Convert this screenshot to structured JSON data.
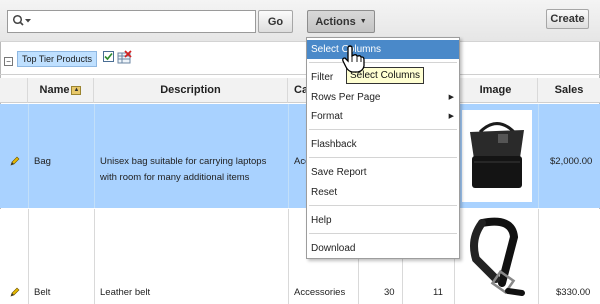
{
  "toolbar": {
    "search_value": "",
    "go_label": "Go",
    "actions_label": "Actions",
    "create_label": "Create"
  },
  "filters": {
    "chip_label": "Top Tier Products"
  },
  "table": {
    "headers": [
      "Name",
      "Description",
      "Ca",
      "Image",
      "Sales"
    ],
    "rows": [
      {
        "name": "Bag",
        "description": "Unisex bag suitable for carrying laptops with room for many additional items",
        "category": "Acc",
        "sales": "$2,000.00"
      },
      {
        "name": "Belt",
        "description": "Leather belt",
        "category": "Accessories",
        "col4": "30",
        "col5": "11",
        "sales": "$330.00"
      }
    ]
  },
  "actions_menu": {
    "items": [
      {
        "label": "Select Columns",
        "submenu": false,
        "active": true
      },
      {
        "label": "Filter",
        "submenu": false
      },
      {
        "label": "Rows Per Page",
        "submenu": true
      },
      {
        "label": "Format",
        "submenu": true
      },
      {
        "label": "Flashback",
        "submenu": false
      },
      {
        "label": "Save Report",
        "submenu": false
      },
      {
        "label": "Reset",
        "submenu": false
      },
      {
        "label": "Help",
        "submenu": false
      },
      {
        "label": "Download",
        "submenu": false
      }
    ],
    "tooltip": "Select Columns"
  },
  "colors": {
    "selected_row": "#a9d2ff",
    "menu_highlight": "#4a89c9",
    "filter_chip": "#bfe0ff"
  }
}
